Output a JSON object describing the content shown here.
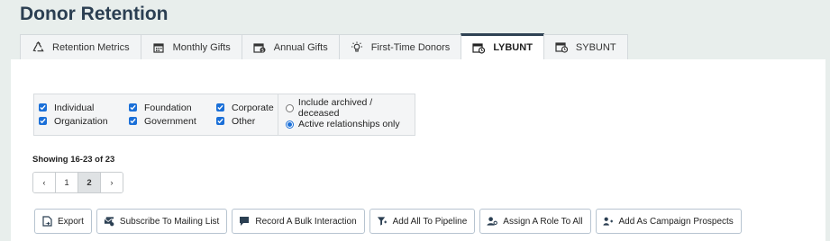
{
  "page_title": "Donor Retention",
  "tabs": [
    {
      "label": "Retention Metrics",
      "icon": "recycle-icon"
    },
    {
      "label": "Monthly Gifts",
      "icon": "calendar-icon"
    },
    {
      "label": "Annual Gifts",
      "icon": "calendar-dollar-icon"
    },
    {
      "label": "First-Time Donors",
      "icon": "lightbulb-icon"
    },
    {
      "label": "LYBUNT",
      "icon": "calendar-clock-icon",
      "active": true
    },
    {
      "label": "SYBUNT",
      "icon": "calendar-clock-icon"
    }
  ],
  "filters": {
    "types": [
      {
        "label": "Individual",
        "checked": true
      },
      {
        "label": "Foundation",
        "checked": true
      },
      {
        "label": "Corporate",
        "checked": true
      },
      {
        "label": "Organization",
        "checked": true
      },
      {
        "label": "Government",
        "checked": true
      },
      {
        "label": "Other",
        "checked": true
      }
    ],
    "status": [
      {
        "label": "Include archived / deceased",
        "selected": false
      },
      {
        "label": "Active relationships only",
        "selected": true
      }
    ]
  },
  "results": {
    "showing": "Showing 16-23 of 23"
  },
  "pagination": {
    "prev": "‹",
    "pages": [
      "1",
      "2"
    ],
    "current": "2",
    "next": "›"
  },
  "actions": [
    {
      "label": "Export",
      "icon": "export-icon"
    },
    {
      "label": "Subscribe To Mailing List",
      "icon": "mailing-list-icon"
    },
    {
      "label": "Record A Bulk Interaction",
      "icon": "comment-icon"
    },
    {
      "label": "Add All To Pipeline",
      "icon": "funnel-icon"
    },
    {
      "label": "Assign A Role To All",
      "icon": "user-role-icon"
    },
    {
      "label": "Add As Campaign Prospects",
      "icon": "campaign-prospect-icon"
    }
  ],
  "colors": {
    "title": "#2b3f52",
    "accent": "#1a6fd8",
    "active_tab_border": "#2f4254"
  }
}
